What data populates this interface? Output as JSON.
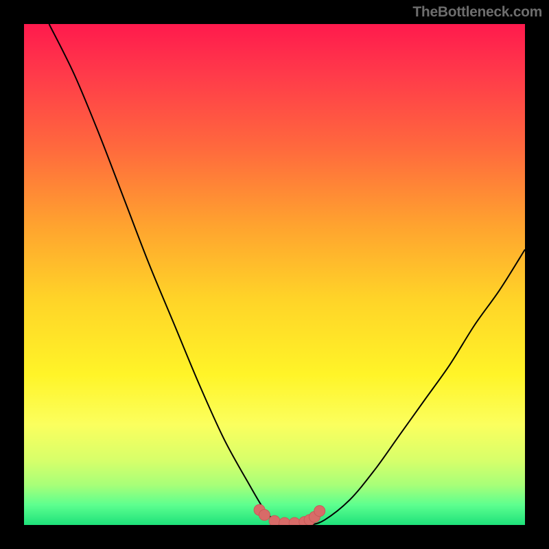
{
  "watermark": "TheBottleneck.com",
  "colors": {
    "frame": "#000000",
    "curve_stroke": "#000000",
    "marker_fill": "#d86b68",
    "marker_stroke": "#c75a58"
  },
  "chart_data": {
    "type": "line",
    "title": "",
    "xlabel": "",
    "ylabel": "",
    "xlim": [
      0,
      100
    ],
    "ylim": [
      0,
      100
    ],
    "grid": false,
    "legend": false,
    "series": [
      {
        "name": "bottleneck-curve",
        "x": [
          5,
          10,
          15,
          20,
          25,
          30,
          35,
          40,
          45,
          48,
          50,
          52,
          55,
          57,
          60,
          65,
          70,
          75,
          80,
          85,
          90,
          95,
          100
        ],
        "y": [
          100,
          90,
          78,
          65,
          52,
          40,
          28,
          17,
          8,
          3,
          1,
          0,
          0,
          0,
          1,
          5,
          11,
          18,
          25,
          32,
          40,
          47,
          55
        ]
      }
    ],
    "markers": {
      "name": "bottleneck-markers",
      "x": [
        47,
        48,
        50,
        52,
        54,
        56,
        57,
        58,
        59
      ],
      "y": [
        3.0,
        2.0,
        0.8,
        0.4,
        0.4,
        0.6,
        1.0,
        1.6,
        2.8
      ]
    }
  }
}
